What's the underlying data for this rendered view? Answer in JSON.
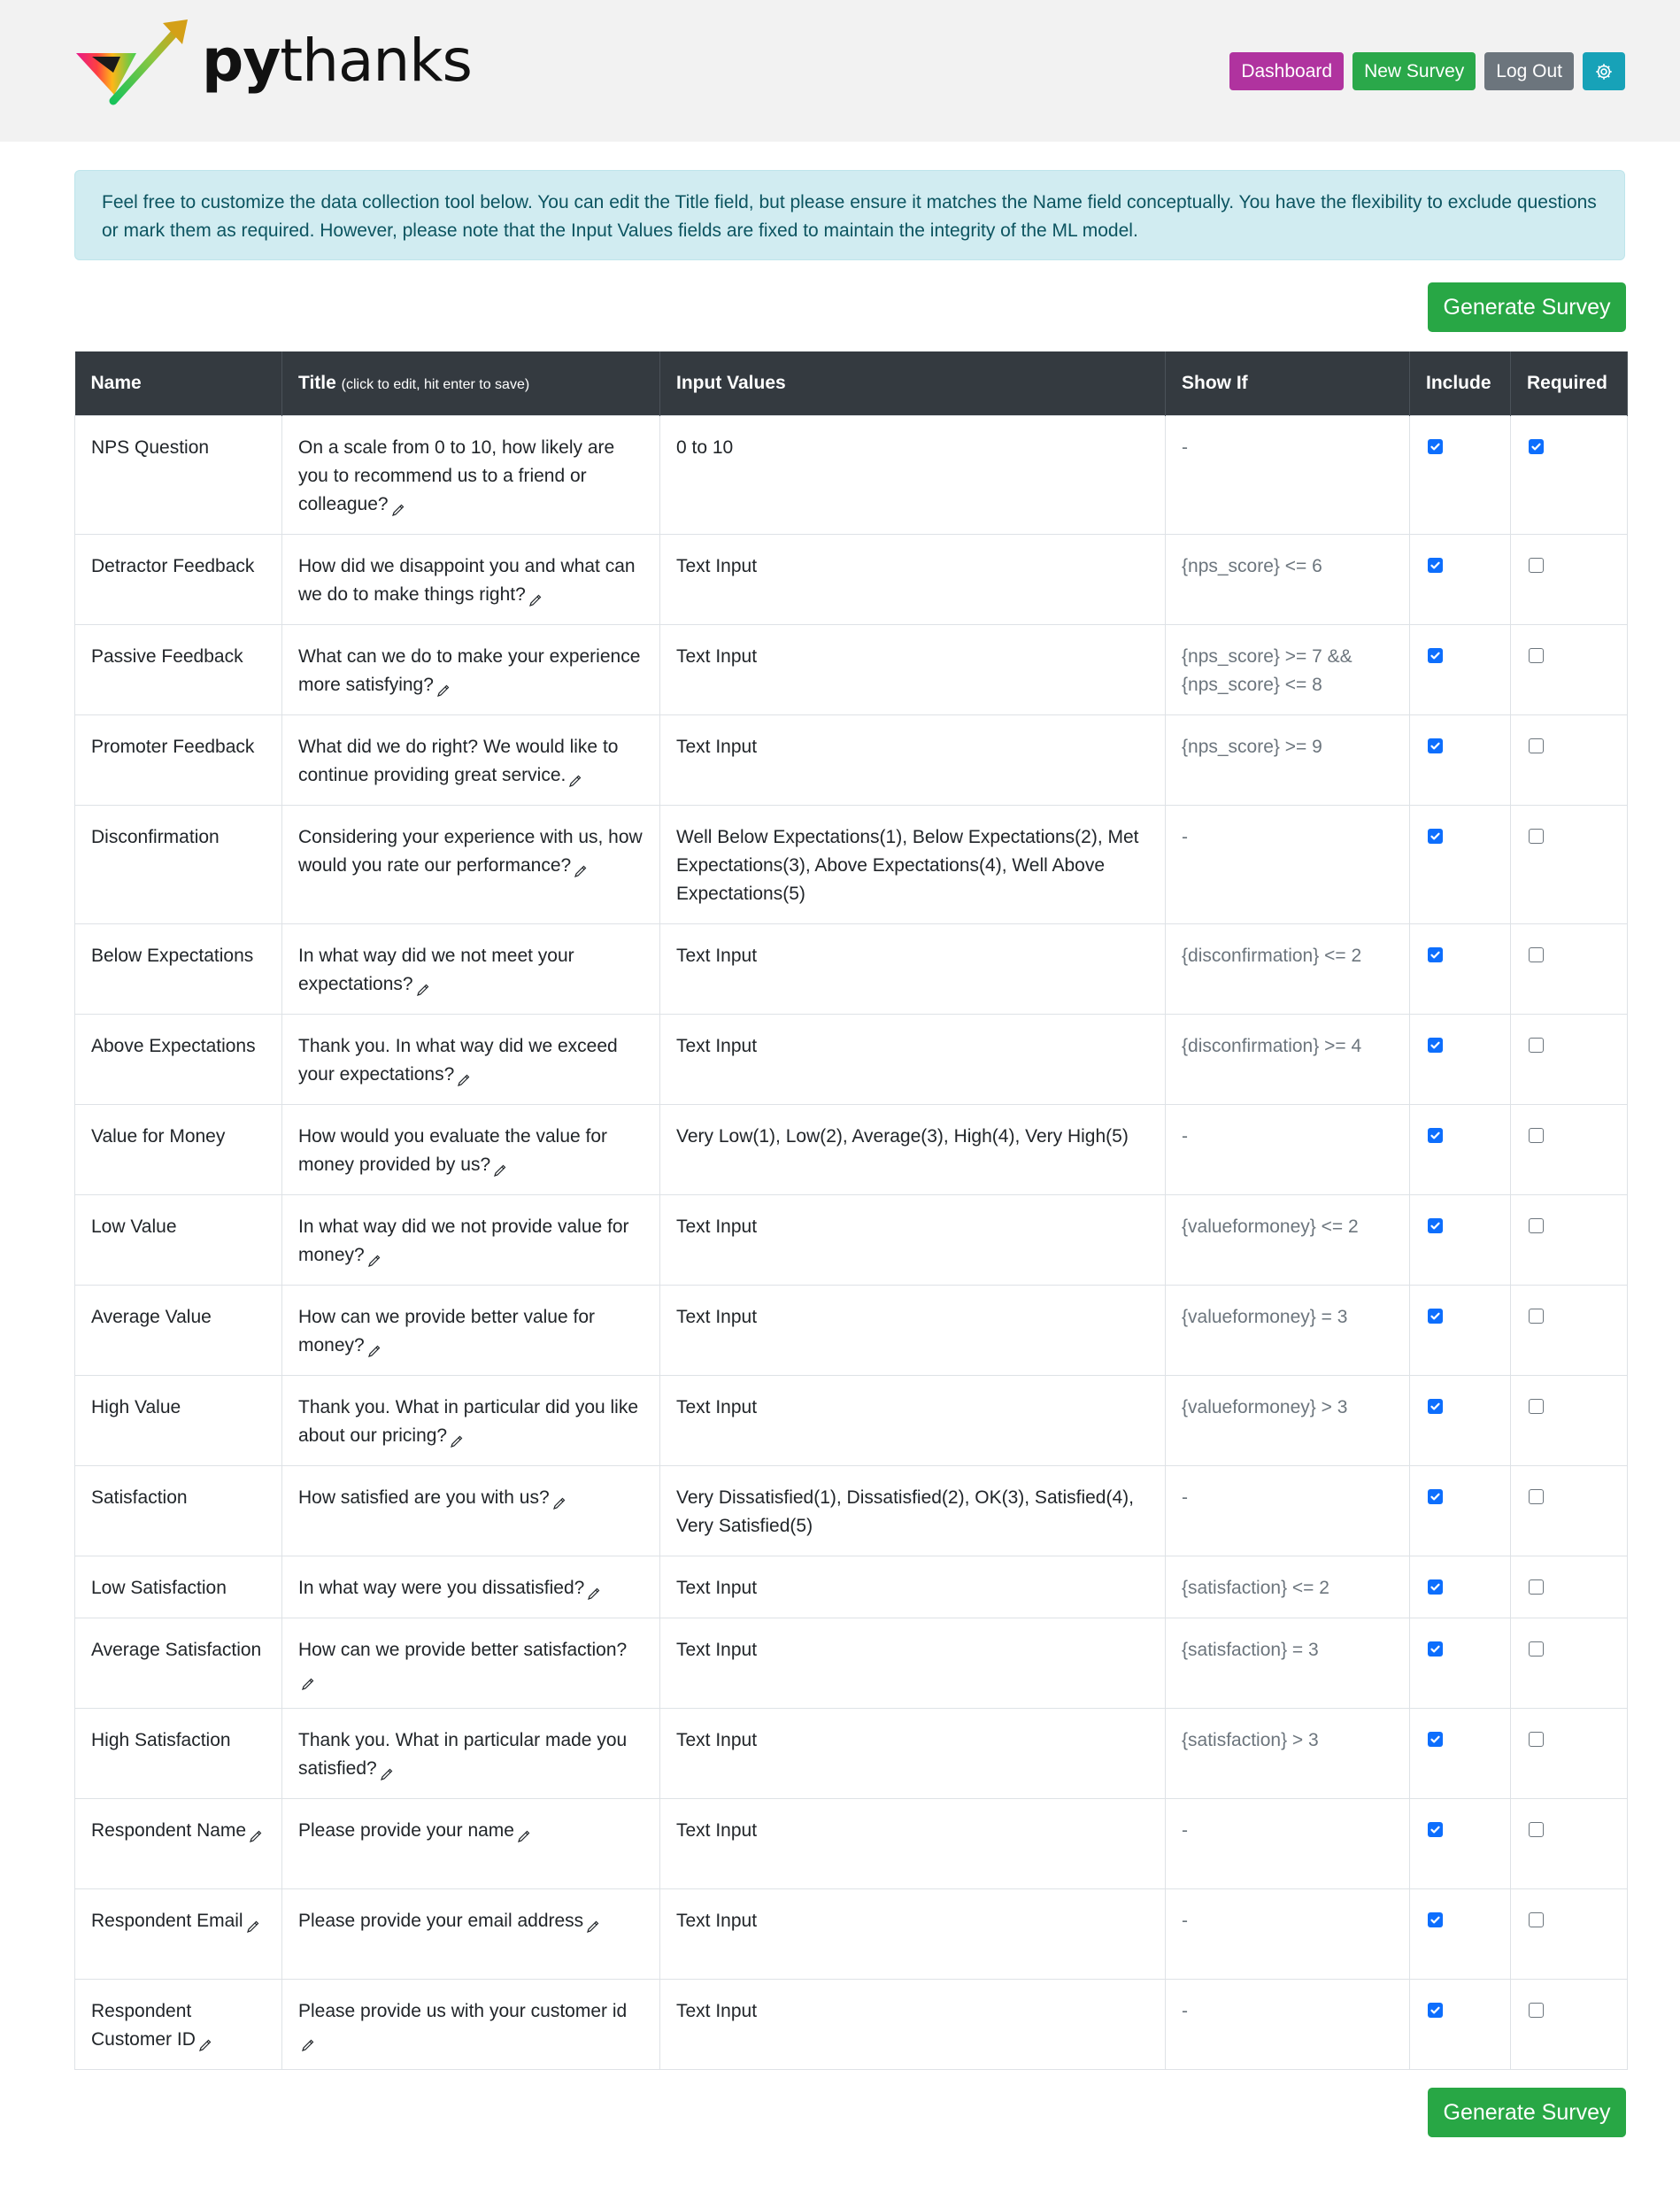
{
  "header": {
    "logo_py": "py",
    "logo_thanks": "thanks",
    "nav": {
      "dashboard": "Dashboard",
      "new_survey": "New Survey",
      "logout": "Log Out",
      "settings_icon": "gear-icon"
    }
  },
  "alert": {
    "text": "Feel free to customize the data collection tool below. You can edit the Title field, but please ensure it matches the Name field conceptually. You have the flexibility to exclude questions or mark them as required. However, please note that the Input Values fields are fixed to maintain the integrity of the ML model."
  },
  "actions": {
    "generate_label": "Generate Survey"
  },
  "table": {
    "headers": {
      "name": "Name",
      "title": "Title",
      "title_hint": "(click to edit, hit enter to save)",
      "input_values": "Input Values",
      "show_if": "Show If",
      "include": "Include",
      "required": "Required"
    },
    "rows": [
      {
        "name": "NPS Question",
        "title": "On a scale from 0 to 10, how likely are you to recommend us to a friend or colleague?",
        "input": "0 to 10",
        "show_if": "-",
        "include": true,
        "required": true,
        "name_edit": false
      },
      {
        "name": "Detractor Feedback",
        "title": "How did we disappoint you and what can we do to make things right?",
        "input": "Text Input",
        "show_if": "{nps_score} <= 6",
        "include": true,
        "required": false,
        "name_edit": false
      },
      {
        "name": "Passive Feedback",
        "title": "What can we do to make your experience more satisfying?",
        "input": "Text Input",
        "show_if": "{nps_score} >= 7 && {nps_score} <= 8",
        "include": true,
        "required": false,
        "name_edit": false
      },
      {
        "name": "Promoter Feedback",
        "title": "What did we do right? We would like to continue providing great service.",
        "input": "Text Input",
        "show_if": "{nps_score} >= 9",
        "include": true,
        "required": false,
        "name_edit": false
      },
      {
        "name": "Disconfirmation",
        "title": "Considering your experience with us, how would you rate our performance?",
        "input": "Well Below Expectations(1), Below Expectations(2), Met Expectations(3), Above Expectations(4), Well Above Expectations(5)",
        "show_if": "-",
        "include": true,
        "required": false,
        "name_edit": false
      },
      {
        "name": "Below Expectations",
        "title": "In what way did we not meet your expectations?",
        "input": "Text Input",
        "show_if": "{disconfirmation} <= 2",
        "include": true,
        "required": false,
        "name_edit": false
      },
      {
        "name": "Above Expectations",
        "title": "Thank you. In what way did we exceed your expectations?",
        "input": "Text Input",
        "show_if": "{disconfirmation} >= 4",
        "include": true,
        "required": false,
        "name_edit": false
      },
      {
        "name": "Value for Money",
        "title": "How would you evaluate the value for money provided by us?",
        "input": "Very Low(1), Low(2), Average(3), High(4), Very High(5)",
        "show_if": "-",
        "include": true,
        "required": false,
        "name_edit": false
      },
      {
        "name": "Low Value",
        "title": "In what way did we not provide value for money?",
        "input": "Text Input",
        "show_if": "{valueformoney} <= 2",
        "include": true,
        "required": false,
        "name_edit": false
      },
      {
        "name": "Average Value",
        "title": "How can we provide better value for money?",
        "input": "Text Input",
        "show_if": "{valueformoney} = 3",
        "include": true,
        "required": false,
        "name_edit": false
      },
      {
        "name": "High Value",
        "title": "Thank you. What in particular did you like about our pricing?",
        "input": "Text Input",
        "show_if": "{valueformoney} > 3",
        "include": true,
        "required": false,
        "name_edit": false
      },
      {
        "name": "Satisfaction",
        "title": "How satisfied are you with us?",
        "input": "Very Dissatisfied(1), Dissatisfied(2), OK(3), Satisfied(4), Very Satisfied(5)",
        "show_if": "-",
        "include": true,
        "required": false,
        "name_edit": false
      },
      {
        "name": "Low Satisfaction",
        "title": "In what way were you dissatisfied?",
        "input": "Text Input",
        "show_if": "{satisfaction} <= 2",
        "include": true,
        "required": false,
        "name_edit": false
      },
      {
        "name": "Average Satisfaction",
        "title": "How can we provide better satisfaction?",
        "input": "Text Input",
        "show_if": "{satisfaction} = 3",
        "include": true,
        "required": false,
        "name_edit": false
      },
      {
        "name": "High Satisfaction",
        "title": "Thank you. What in particular made you satisfied?",
        "input": "Text Input",
        "show_if": "{satisfaction} > 3",
        "include": true,
        "required": false,
        "name_edit": false
      },
      {
        "name": "Respondent Name",
        "title": "Please provide your name",
        "input": "Text Input",
        "show_if": "-",
        "include": true,
        "required": false,
        "name_edit": true
      },
      {
        "name": "Respondent Email",
        "title": "Please provide your email address",
        "input": "Text Input",
        "show_if": "-",
        "include": true,
        "required": false,
        "name_edit": true
      },
      {
        "name": "Respondent Customer ID",
        "title": "Please provide us with your customer id",
        "input": "Text Input",
        "show_if": "-",
        "include": true,
        "required": false,
        "name_edit": true
      }
    ]
  },
  "colors": {
    "dashboard": "#b0339f",
    "new_survey": "#2aa84a",
    "logout": "#6c757d",
    "settings": "#17a2b8",
    "generate": "#28a745",
    "table_header": "#343a40",
    "alert_bg": "#d1ecf1",
    "checkbox": "#0d6efd"
  }
}
